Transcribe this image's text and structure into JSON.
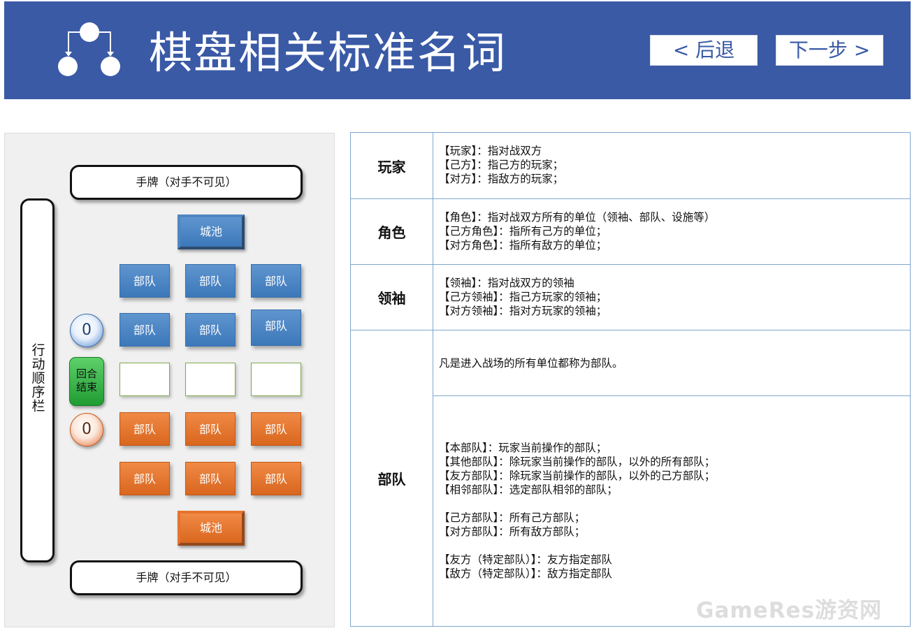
{
  "header": {
    "title": "棋盘相关标准名词",
    "back_label": "< 后退",
    "next_label": "下一步 >",
    "bg_color": "#3a5aa6"
  },
  "board": {
    "hand_top": "手牌（对手不可见）",
    "hand_bottom": "手牌（对手不可见）",
    "order_bar": "行动顺序栏",
    "city_blue": "城池",
    "city_orange": "城池",
    "unit_label": "部队",
    "counter_top": "0",
    "counter_bottom": "0",
    "end_turn": "回合结束",
    "colors": {
      "player_a": "#4a86c4",
      "player_b": "#e0702a",
      "end_turn": "#2fae3f"
    }
  },
  "glossary": {
    "rows": [
      {
        "term": "玩家",
        "defs": [
          "【玩家】：指对战双方",
          "【己方】：指己方的玩家；",
          "【对方】：指敌方的玩家；"
        ]
      },
      {
        "term": "角色",
        "defs": [
          "【角色】：指对战双方所有的单位（领袖、部队、设施等）",
          "【己方角色】：指所有己方的单位；",
          "【对方角色】：指所有敌方的单位；"
        ]
      },
      {
        "term": "领袖",
        "defs": [
          "【领袖】：指对战双方的领袖",
          "【己方领袖】：指己方玩家的领袖；",
          "【对方领袖】：指对方玩家的领袖；"
        ]
      },
      {
        "term": "部队",
        "intro": "凡是进入战场的所有单位都称为部队。",
        "defs": [
          "【本部队】：玩家当前操作的部队；",
          "【其他部队】：除玩家当前操作的部队，以外的所有部队；",
          "【友方部队】：除玩家当前操作的部队，以外的己方部队；",
          "【相邻部队】：选定部队相邻的部队；",
          "【己方部队】：所有己方部队；",
          "【对方部队】：所有敌方部队；",
          "【友方（特定部队）】：友方指定部队",
          "【敌方（特定部队）】：敌方指定部队"
        ]
      }
    ]
  },
  "watermark": "GameRes游资网"
}
